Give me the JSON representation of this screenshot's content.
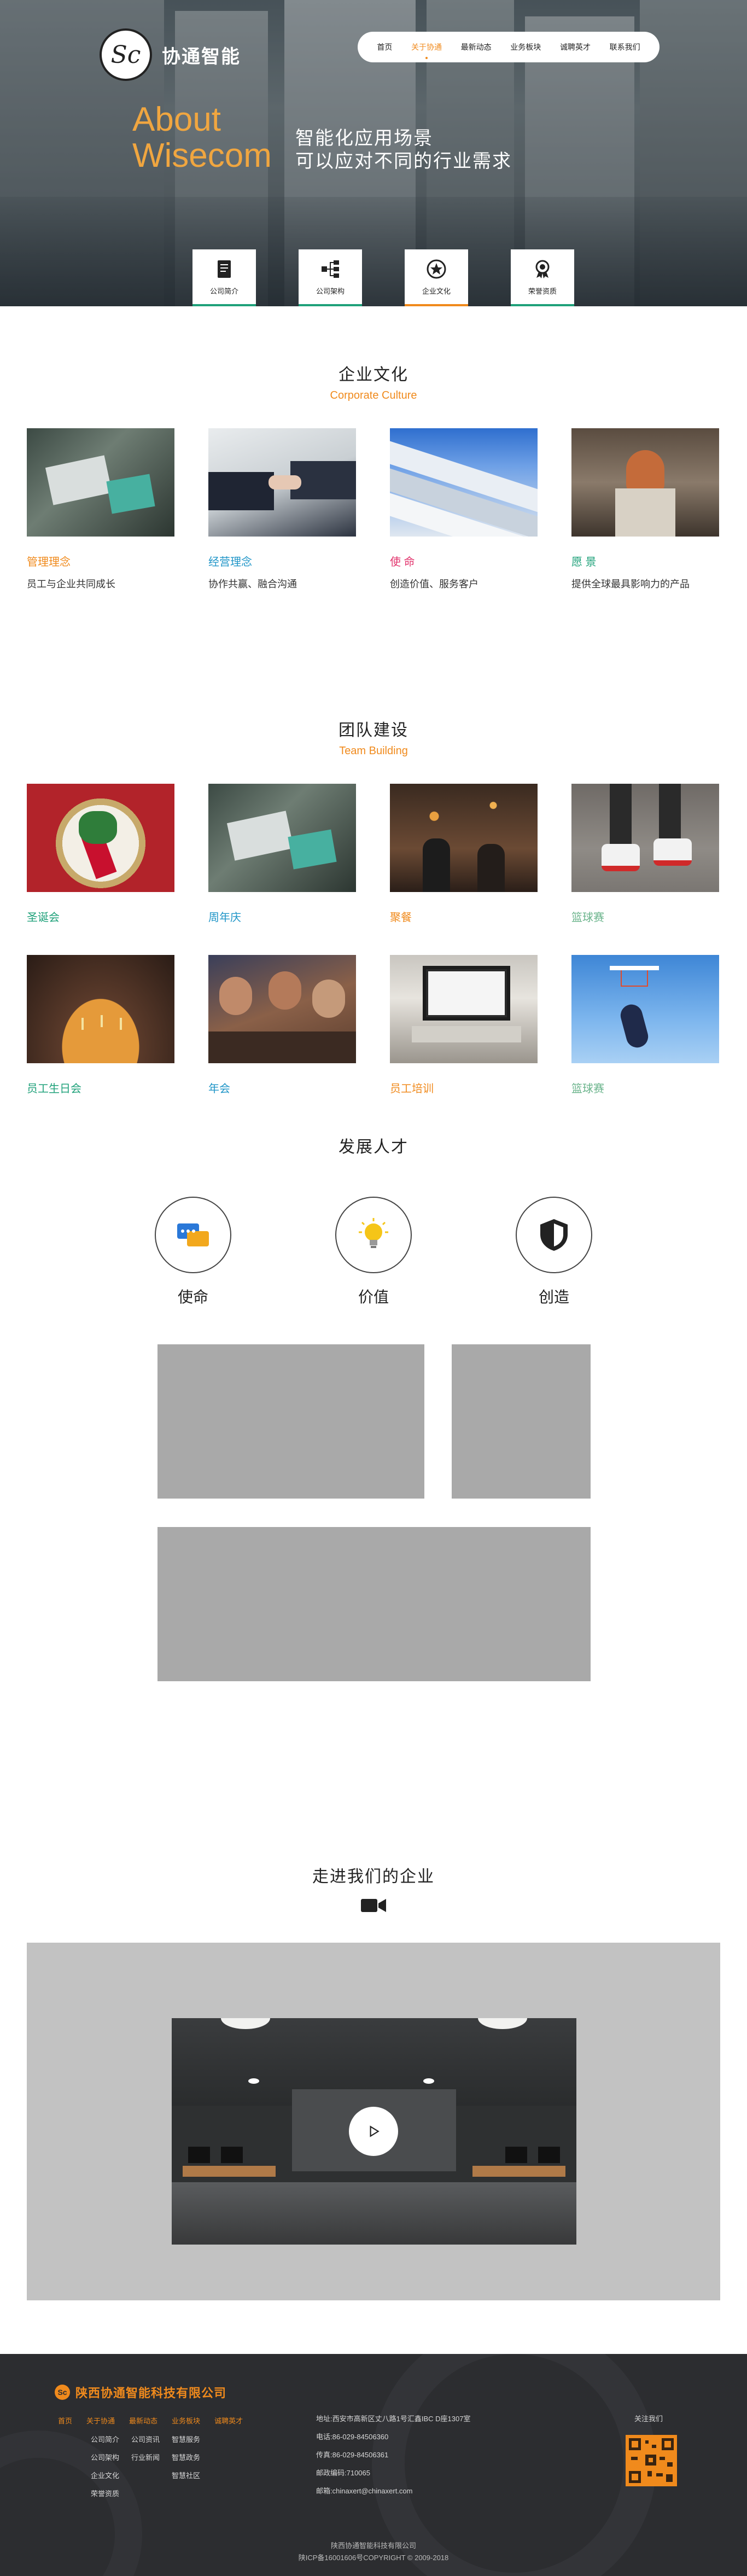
{
  "brand": {
    "logo_glyph": "Sc",
    "name": "协通智能"
  },
  "nav": {
    "items": [
      {
        "label": "首页"
      },
      {
        "label": "关于协通"
      },
      {
        "label": "最新动态"
      },
      {
        "label": "业务板块"
      },
      {
        "label": "诚聘英才"
      },
      {
        "label": "联系我们"
      }
    ],
    "active_index": 1
  },
  "hero": {
    "en_line1": "About",
    "en_line2": "Wisecom",
    "cn_line1": "智能化应用场景",
    "cn_line2": "可以应对不同的行业需求"
  },
  "cards": [
    {
      "label": "公司简介",
      "icon": "document-icon"
    },
    {
      "label": "公司架构",
      "icon": "org-chart-icon"
    },
    {
      "label": "企业文化",
      "icon": "star-badge-icon"
    },
    {
      "label": "荣誉资质",
      "icon": "medal-icon"
    }
  ],
  "culture": {
    "title": "企业文化",
    "subtitle": "Corporate Culture",
    "items": [
      {
        "title": "管理理念",
        "desc": "员工与企业共同成长",
        "color": "#f08a1c"
      },
      {
        "title": "经营理念",
        "desc": "协作共赢、融合沟通",
        "color": "#2196c8"
      },
      {
        "title": "使  命",
        "desc": "创造价值、服务客户",
        "color": "#e2346d"
      },
      {
        "title": "愿  景",
        "desc": "提供全球最具影响力的产品",
        "color": "#1fa17a"
      }
    ]
  },
  "team": {
    "title": "团队建设",
    "subtitle": "Team Building",
    "row1": [
      {
        "title": "圣诞会",
        "color": "#1fa17a"
      },
      {
        "title": "周年庆",
        "color": "#2196c8"
      },
      {
        "title": "聚餐",
        "color": "#f08a1c"
      },
      {
        "title": "篮球赛",
        "color": "#6bb48c"
      }
    ],
    "row2": [
      {
        "title": "员工生日会",
        "color": "#1fa17a"
      },
      {
        "title": "年会",
        "color": "#2196c8"
      },
      {
        "title": "员工培训",
        "color": "#f08a1c"
      },
      {
        "title": "篮球赛",
        "color": "#6bb48c"
      }
    ]
  },
  "talent": {
    "title": "发展人才",
    "items": [
      {
        "label": "使命",
        "icon": "chat-bubbles-icon"
      },
      {
        "label": "价值",
        "icon": "lightbulb-icon"
      },
      {
        "label": "创造",
        "icon": "shield-icon"
      }
    ]
  },
  "enterprise": {
    "title": "走进我们的企业",
    "icon": "video-camera-icon"
  },
  "footer": {
    "company_name": "陕西协通智能科技有限公司",
    "nav": [
      "首页",
      "关于协通",
      "最新动态",
      "业务板块",
      "诚聘英才"
    ],
    "col_about": [
      "公司简介",
      "公司架构",
      "企业文化",
      "荣誉资质"
    ],
    "col_news": [
      "公司资讯",
      "行业新闻"
    ],
    "col_business": [
      "智慧服务",
      "智慧政务",
      "智慧社区"
    ],
    "address": "地址:西安市高新区丈八路1号汇鑫IBC D座1307室",
    "phone": "电话:86-029-84506360",
    "fax": "传真:86-029-84506361",
    "postcode": "邮政编码:710065",
    "email": "邮箱:chinaxert@chinaxert.com",
    "follow_label": "关注我们",
    "bottom_company": "陕西协通智能科技有限公司",
    "icp": "陕ICP备16001606号COPYRIGHT © 2009-2018"
  }
}
